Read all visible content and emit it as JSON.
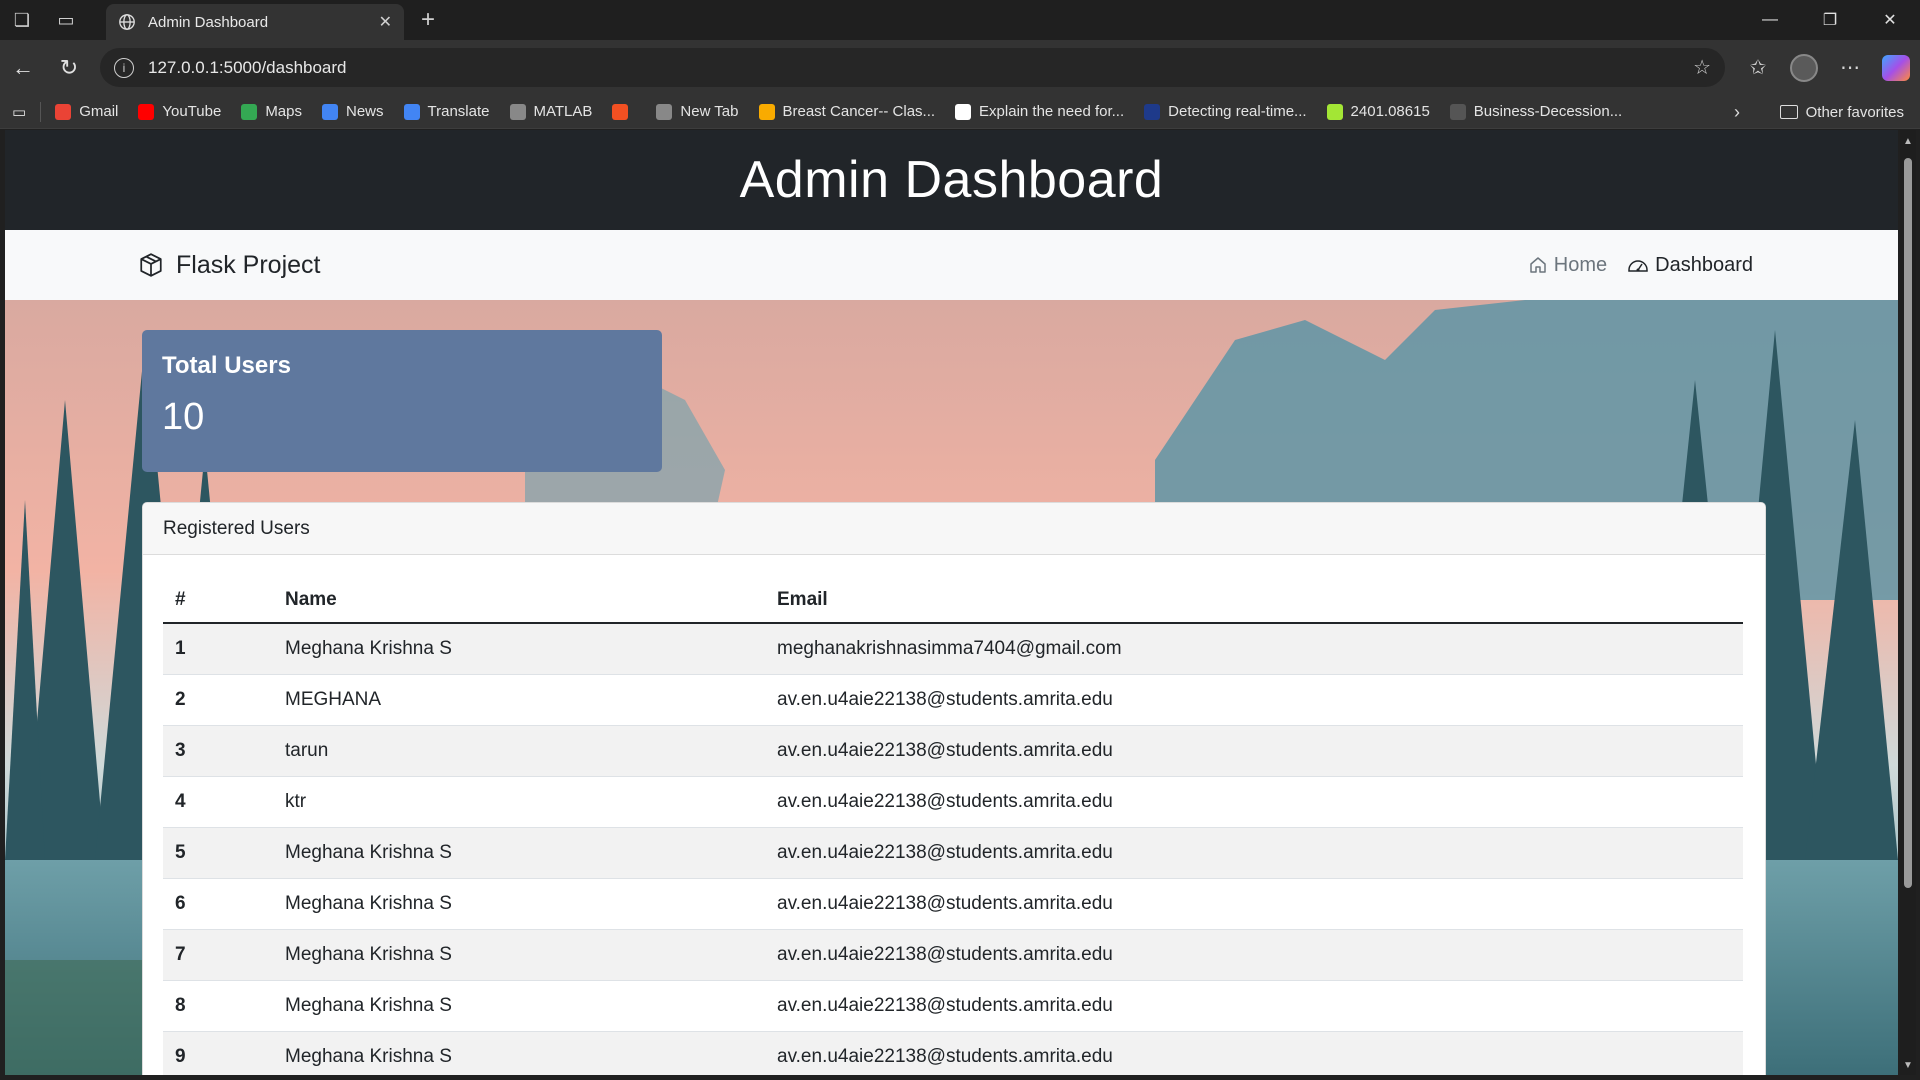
{
  "browser": {
    "tab_title": "Admin Dashboard",
    "url": "127.0.0.1:5000/dashboard",
    "bookmarks": [
      {
        "label": "Gmail",
        "color": "#ea4335"
      },
      {
        "label": "YouTube",
        "color": "#ff0000"
      },
      {
        "label": "Maps",
        "color": "#34a853"
      },
      {
        "label": "News",
        "color": "#4285f4"
      },
      {
        "label": "Translate",
        "color": "#4285f4"
      },
      {
        "label": "MATLAB",
        "color": "#888888"
      },
      {
        "label": "",
        "color": "#f25022"
      },
      {
        "label": "New Tab",
        "color": "#888888"
      },
      {
        "label": "Breast Cancer-- Clas...",
        "color": "#f9ab00"
      },
      {
        "label": "Explain the need for...",
        "color": "#ffffff"
      },
      {
        "label": "Detecting real-time...",
        "color": "#1e3a8a"
      },
      {
        "label": "2401.08615",
        "color": "#a3e635"
      },
      {
        "label": "Business-Decession...",
        "color": "#555555"
      }
    ],
    "other_favorites": "Other favorites"
  },
  "page": {
    "header_title": "Admin Dashboard",
    "brand": "Flask Project",
    "nav": {
      "home": "Home",
      "dashboard": "Dashboard"
    }
  },
  "stats": {
    "total_users_label": "Total Users",
    "total_users_value": "10"
  },
  "users": {
    "card_title": "Registered Users",
    "columns": [
      "#",
      "Name",
      "Email"
    ],
    "rows": [
      {
        "id": "1",
        "name": "Meghana Krishna S",
        "email": "meghanakrishnasimma7404@gmail.com"
      },
      {
        "id": "2",
        "name": "MEGHANA",
        "email": "av.en.u4aie22138@students.amrita.edu"
      },
      {
        "id": "3",
        "name": "tarun",
        "email": "av.en.u4aie22138@students.amrita.edu"
      },
      {
        "id": "4",
        "name": "ktr",
        "email": "av.en.u4aie22138@students.amrita.edu"
      },
      {
        "id": "5",
        "name": "Meghana Krishna S",
        "email": "av.en.u4aie22138@students.amrita.edu"
      },
      {
        "id": "6",
        "name": "Meghana Krishna S",
        "email": "av.en.u4aie22138@students.amrita.edu"
      },
      {
        "id": "7",
        "name": "Meghana Krishna S",
        "email": "av.en.u4aie22138@students.amrita.edu"
      },
      {
        "id": "8",
        "name": "Meghana Krishna S",
        "email": "av.en.u4aie22138@students.amrita.edu"
      },
      {
        "id": "9",
        "name": "Meghana Krishna S",
        "email": "av.en.u4aie22138@students.amrita.edu"
      }
    ]
  },
  "colors": {
    "header_bg": "#212529",
    "navbar_bg": "#f8f9fa",
    "stat_card_bg": "#5f789e"
  }
}
